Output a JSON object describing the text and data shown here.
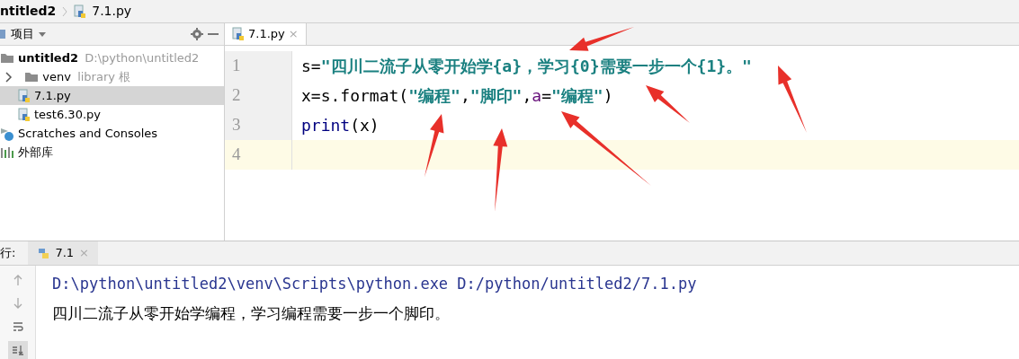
{
  "breadcrumb": [
    {
      "label": "ntitled2",
      "kind": "folder"
    },
    {
      "label": "7.1.py",
      "kind": "python"
    }
  ],
  "project_panel": {
    "title": "项目",
    "tree": [
      {
        "label": "untitled2",
        "hint": "D:\\python\\untitled2",
        "kind": "folder",
        "selected": false,
        "children": [
          {
            "label": "venv",
            "hint": "library 根",
            "kind": "folder",
            "selected": false,
            "expanded": false
          },
          {
            "label": "7.1.py",
            "kind": "python",
            "selected": true
          },
          {
            "label": "test6.30.py",
            "kind": "python",
            "selected": false
          }
        ]
      },
      {
        "label": "Scratches and Consoles",
        "kind": "scratch",
        "selected": false
      },
      {
        "label": "外部库",
        "kind": "library",
        "selected": false
      }
    ]
  },
  "editor": {
    "tabs": [
      {
        "label": "7.1.py",
        "close": "×",
        "selected": true
      }
    ],
    "lines": [
      {
        "number": "1",
        "current": false,
        "tokens": [
          {
            "text": "s=",
            "kind": "plain"
          },
          {
            "text": "\"四川二流子从零开始学{a}，学习{0}需要一步一个{1}。\"",
            "kind": "string"
          }
        ]
      },
      {
        "number": "2",
        "current": false,
        "tokens": [
          {
            "text": "x=s.format(",
            "kind": "plain"
          },
          {
            "text": "\"编程\"",
            "kind": "string"
          },
          {
            "text": ",",
            "kind": "plain"
          },
          {
            "text": "\"脚印\"",
            "kind": "string"
          },
          {
            "text": ",",
            "kind": "plain"
          },
          {
            "text": "a",
            "kind": "param"
          },
          {
            "text": "=",
            "kind": "plain"
          },
          {
            "text": "\"编程\"",
            "kind": "string"
          },
          {
            "text": ")",
            "kind": "plain"
          }
        ]
      },
      {
        "number": "3",
        "current": false,
        "tokens": [
          {
            "text": "print",
            "kind": "builtin"
          },
          {
            "text": "(x)",
            "kind": "plain"
          }
        ]
      },
      {
        "number": "4",
        "current": true
      }
    ]
  },
  "run_panel": {
    "label": "行:",
    "tabs": [
      {
        "label": "7.1",
        "close": "×",
        "selected": true
      }
    ],
    "output": [
      {
        "text": "D:\\python\\untitled2\\venv\\Scripts\\python.exe D:/python/untitled2/7.1.py",
        "kind": "command"
      },
      {
        "text": "四川二流子从零开始学编程，学习编程需要一步一个脚印。",
        "kind": "stdout"
      }
    ]
  }
}
